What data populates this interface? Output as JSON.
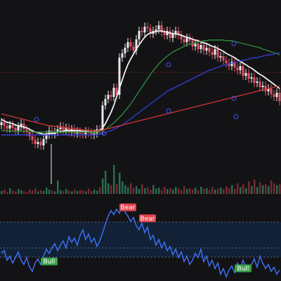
{
  "colors": {
    "background": "#131315",
    "candle_up": "#e8e8ec",
    "candle_down": "#e05466",
    "ma_fast": "#f0f0f0",
    "ma_mid": "#2e8b3a",
    "ma_slow": "#2f3fd6",
    "ma_long": "#d23434",
    "oscillator": "#3d6ff0",
    "oscillator_band": "#13233a",
    "volume_up": "#2e7d5f",
    "volume_down": "#8a2e35",
    "bull_tag": "#3aa24a",
    "bear_tag": "#e2454f",
    "reference_line": "#b0333a"
  },
  "chart_data": [
    {
      "type": "candlestick",
      "x": [
        0,
        4,
        8,
        12,
        16,
        20,
        24,
        28,
        32,
        36,
        40,
        44,
        48,
        52,
        56,
        60,
        64,
        68,
        72,
        76,
        80,
        84,
        88,
        92,
        96,
        100,
        104,
        108,
        112,
        116,
        120,
        124,
        128,
        132,
        136,
        140,
        144,
        148,
        152,
        156,
        160,
        164,
        168,
        172,
        176,
        180,
        184,
        188,
        192,
        196,
        200,
        204,
        208,
        212,
        216,
        220,
        224,
        228,
        232,
        236,
        240,
        244,
        248,
        252,
        256,
        260,
        264,
        268,
        272,
        276,
        280,
        284,
        288,
        292,
        296,
        300,
        304,
        308,
        312,
        316,
        320,
        324,
        328,
        332,
        336,
        340,
        344,
        348,
        352,
        356,
        360,
        364,
        368,
        372,
        376,
        380,
        384,
        388,
        392,
        396
      ],
      "close": [
        174,
        179,
        183,
        178,
        182,
        186,
        180,
        176,
        184,
        188,
        194,
        199,
        205,
        202,
        207,
        198,
        192,
        186,
        191,
        188,
        184,
        180,
        186,
        182,
        188,
        184,
        190,
        187,
        190,
        191,
        187,
        189,
        192,
        190,
        184,
        186,
        150,
        141,
        135,
        138,
        125,
        135,
        82,
        76,
        68,
        60,
        66,
        72,
        56,
        44,
        46,
        38,
        40,
        48,
        44,
        42,
        36,
        46,
        50,
        44,
        54,
        48,
        44,
        50,
        56,
        60,
        54,
        58,
        66,
        62,
        70,
        64,
        72,
        68,
        74,
        78,
        70,
        82,
        80,
        86,
        90,
        94,
        88,
        96,
        100,
        94,
        108,
        104,
        112,
        110,
        118,
        116,
        124,
        122,
        130,
        126,
        134,
        138,
        132,
        144
      ],
      "open_offset_pattern": "close of previous bar",
      "ylim": [
        0,
        270
      ]
    },
    {
      "type": "line",
      "series": [
        {
          "key": "ma_fast",
          "values": [
            170,
            172,
            174,
            175,
            176,
            178,
            179,
            180,
            181,
            182,
            184,
            186,
            188,
            189,
            190,
            191,
            191,
            190,
            190,
            189,
            188,
            187,
            187,
            186,
            186,
            186,
            186,
            186,
            186,
            187,
            187,
            187,
            188,
            188,
            187,
            186,
            182,
            176,
            168,
            160,
            150,
            138,
            126,
            114,
            102,
            92,
            84,
            77,
            70,
            64,
            58,
            53,
            49,
            47,
            46,
            45,
            44,
            44,
            45,
            46,
            47,
            48,
            48,
            49,
            50,
            52,
            53,
            54,
            56,
            57,
            58,
            60,
            61,
            62,
            64,
            66,
            67,
            69,
            71,
            73,
            76,
            78,
            80,
            82,
            85,
            87,
            90,
            92,
            95,
            97,
            100,
            103,
            106,
            108,
            111,
            114,
            117,
            120,
            123,
            126
          ]
        },
        {
          "key": "ma_mid",
          "values": [
            186,
            186,
            186,
            186,
            187,
            187,
            187,
            187,
            187,
            187,
            187,
            188,
            188,
            188,
            188,
            188,
            188,
            188,
            188,
            188,
            188,
            188,
            188,
            188,
            188,
            188,
            188,
            188,
            188,
            188,
            188,
            188,
            188,
            188,
            188,
            187,
            186,
            184,
            181,
            178,
            175,
            171,
            167,
            163,
            158,
            153,
            148,
            142,
            136,
            130,
            124,
            118,
            112,
            106,
            101,
            96,
            91,
            87,
            83,
            80,
            77,
            74,
            72,
            70,
            68,
            66,
            64,
            63,
            62,
            61,
            60,
            59,
            58,
            58,
            57,
            57,
            57,
            57,
            57,
            57,
            58,
            58,
            58,
            59,
            60,
            61,
            62,
            63,
            64,
            65,
            66,
            67,
            68,
            70,
            71,
            72,
            74,
            75,
            76,
            78
          ]
        },
        {
          "key": "ma_slow",
          "values": [
            192,
            192,
            192,
            192,
            192,
            192,
            192,
            192,
            192,
            192,
            192,
            192,
            192,
            192,
            192,
            192,
            192,
            192,
            192,
            192,
            192,
            192,
            192,
            192,
            192,
            192,
            192,
            192,
            192,
            192,
            192,
            192,
            192,
            192,
            192,
            191,
            190,
            189,
            187,
            186,
            184,
            182,
            180,
            178,
            175,
            172,
            169,
            166,
            163,
            160,
            157,
            154,
            151,
            148,
            145,
            142,
            139,
            136,
            133,
            130,
            128,
            126,
            124,
            122,
            120,
            118,
            116,
            114,
            112,
            110,
            108,
            106,
            104,
            102,
            100,
            99,
            97,
            96,
            94,
            93,
            92,
            91,
            90,
            89,
            88,
            87,
            86,
            85,
            84,
            83,
            82,
            82,
            81,
            80,
            79,
            78,
            78,
            77,
            76,
            75
          ]
        },
        {
          "key": "ma_long",
          "values": [
            162,
            163,
            164,
            165,
            166,
            167,
            168,
            169,
            170,
            171,
            172,
            173,
            174,
            175,
            176,
            177,
            178,
            179,
            179,
            180,
            180,
            181,
            181,
            182,
            182,
            183,
            183,
            184,
            184,
            185,
            185,
            186,
            186,
            186,
            186,
            186,
            185,
            184,
            183,
            182,
            181,
            180,
            179,
            178,
            177,
            176,
            175,
            174,
            173,
            172,
            171,
            170,
            169,
            168,
            167,
            166,
            165,
            164,
            163,
            162,
            161,
            160,
            159,
            158,
            157,
            156,
            155,
            154,
            153,
            152,
            151,
            150,
            149,
            148,
            147,
            146,
            145,
            144,
            143,
            142,
            141,
            140,
            139,
            138,
            137,
            136,
            135,
            134,
            133,
            132,
            131,
            130,
            129,
            128,
            127,
            126,
            125,
            124,
            123,
            122
          ]
        }
      ],
      "crossover_markers_x": [
        52,
        148,
        240,
        240,
        333,
        333,
        336
      ]
    },
    {
      "type": "bar",
      "name": "volume",
      "values": [
        6,
        9,
        4,
        12,
        7,
        5,
        10,
        8,
        6,
        4,
        9,
        7,
        11,
        5,
        8,
        6,
        13,
        9,
        7,
        5,
        28,
        8,
        6,
        10,
        7,
        5,
        9,
        6,
        8,
        7,
        5,
        11,
        6,
        9,
        7,
        14,
        32,
        48,
        22,
        18,
        60,
        20,
        44,
        26,
        18,
        14,
        22,
        12,
        16,
        10,
        20,
        12,
        14,
        9,
        18,
        11,
        13,
        8,
        15,
        10,
        12,
        9,
        14,
        11,
        8,
        16,
        10,
        12,
        9,
        13,
        7,
        15,
        10,
        12,
        8,
        14,
        9,
        11,
        13,
        10,
        16,
        12,
        18,
        11,
        22,
        14,
        20,
        12,
        26,
        16,
        30,
        14,
        24,
        18,
        20,
        16,
        28,
        22,
        18,
        20
      ],
      "ylim": [
        0,
        70
      ]
    },
    {
      "type": "line",
      "name": "oscillator",
      "values": [
        40,
        44,
        30,
        36,
        26,
        34,
        42,
        30,
        24,
        34,
        20,
        14,
        26,
        32,
        24,
        36,
        46,
        40,
        48,
        54,
        44,
        52,
        58,
        48,
        64,
        56,
        62,
        52,
        66,
        74,
        60,
        68,
        56,
        62,
        50,
        58,
        70,
        82,
        94,
        102,
        96,
        104,
        98,
        110,
        100,
        94,
        86,
        92,
        80,
        74,
        84,
        70,
        78,
        60,
        66,
        52,
        60,
        48,
        56,
        44,
        50,
        38,
        46,
        34,
        42,
        28,
        36,
        24,
        30,
        40,
        34,
        46,
        28,
        36,
        22,
        30,
        18,
        26,
        10,
        18,
        6,
        16,
        22,
        12,
        26,
        18,
        30,
        20,
        14,
        24,
        32,
        20,
        36,
        26,
        18,
        24,
        14,
        20,
        10,
        16
      ],
      "ylim": [
        0,
        120
      ],
      "tags": [
        {
          "label": "Bull",
          "index": 17
        },
        {
          "label": "Bear",
          "index": 45
        },
        {
          "label": "Bear",
          "index": 52
        },
        {
          "label": "Bull",
          "index": 86
        }
      ]
    }
  ]
}
